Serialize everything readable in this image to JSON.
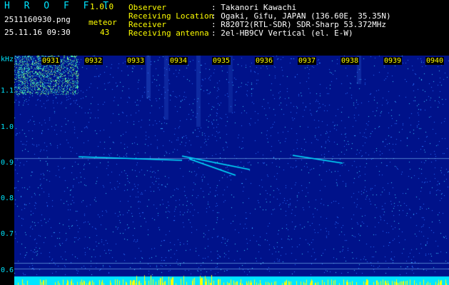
{
  "header": {
    "app_name": "H R O F F T",
    "version": "1.0.0",
    "filename": "2511160930.png",
    "datetime": "25.11.16 09:30",
    "meteor_label": "meteor",
    "meteor_count": "43",
    "fields": [
      {
        "label": "Observer",
        "value": ": Takanori Kawachi"
      },
      {
        "label": "Receiving Location",
        "value": ": Ogaki, Gifu, JAPAN (136.60E, 35.35N)"
      },
      {
        "label": "Receiver",
        "value": ": R820T2(RTL-SDR) SDR-Sharp 53.372MHz"
      },
      {
        "label": "Receiving antenna",
        "value": ": 2el-HB9CV Vertical (el. E-W)"
      }
    ]
  },
  "chart_data": {
    "type": "heatmap",
    "ylabel": "kHz",
    "y_ticks": [
      "1.1",
      "1.0",
      "0.9",
      "0.8",
      "0.7",
      "0.6"
    ],
    "x_ticks": [
      "0931",
      "0932",
      "0933",
      "0934",
      "0935",
      "0936",
      "0937",
      "0938",
      "0939",
      "0940"
    ],
    "colors": {
      "background": "#00128a",
      "noise": "#2a6fff",
      "signal": "#00e5ff",
      "strong": "#ffff00"
    }
  }
}
